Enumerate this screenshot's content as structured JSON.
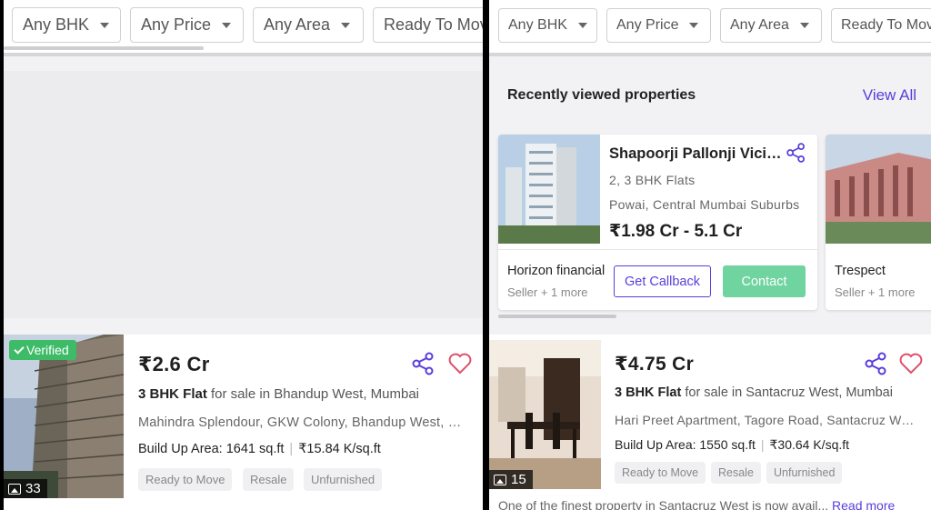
{
  "filters": [
    "Any BHK",
    "Any Price",
    "Any Area",
    "Ready To Move"
  ],
  "left_listing": {
    "verified_label": "Verified",
    "photo_count": "33",
    "price": "₹2.6 Cr",
    "bhk": "3 BHK Flat",
    "title_rest": " for sale in Bhandup West, Mumbai",
    "address": "Mahindra Splendour, GKW Colony, Bhandup West, Mumbai",
    "build_up": "Build Up Area: 1641 sq.ft",
    "rate": "₹15.84 K/sq.ft",
    "tags": [
      "Ready to Move",
      "Resale",
      "Unfurnished"
    ]
  },
  "recently_viewed": {
    "heading": "Recently viewed properties",
    "view_all": "View All",
    "card": {
      "name": "Shapoorji Pallonji Vicinia",
      "config": "2, 3 BHK Flats",
      "location": "Powai, Central Mumbai Suburbs",
      "price": "₹1.98 Cr - 5.1 Cr",
      "seller": "Horizon financial",
      "seller_sub": "Seller + 1 more",
      "callback_label": "Get Callback",
      "contact_label": "Contact"
    },
    "next_card": {
      "seller": "Trespect",
      "seller_sub": "Seller + 1 more"
    }
  },
  "right_listing": {
    "photo_count": "15",
    "price": "₹4.75 Cr",
    "bhk": "3 BHK Flat",
    "title_rest": " for sale in Santacruz West, Mumbai",
    "address": "Hari Preet Apartment, Tagore Road, Santacruz West",
    "build_up": "Build Up Area: 1550 sq.ft",
    "rate": "₹30.64 K/sq.ft",
    "tags": [
      "Ready to Move",
      "Resale",
      "Unfurnished"
    ],
    "description": "One of the finest property in Santacruz West is now avail...",
    "read_more": "Read more"
  },
  "colors": {
    "accent": "#5a3ddc",
    "verified": "#3dbb67",
    "contact": "#6fd4a0",
    "heart": "#e0506a"
  }
}
